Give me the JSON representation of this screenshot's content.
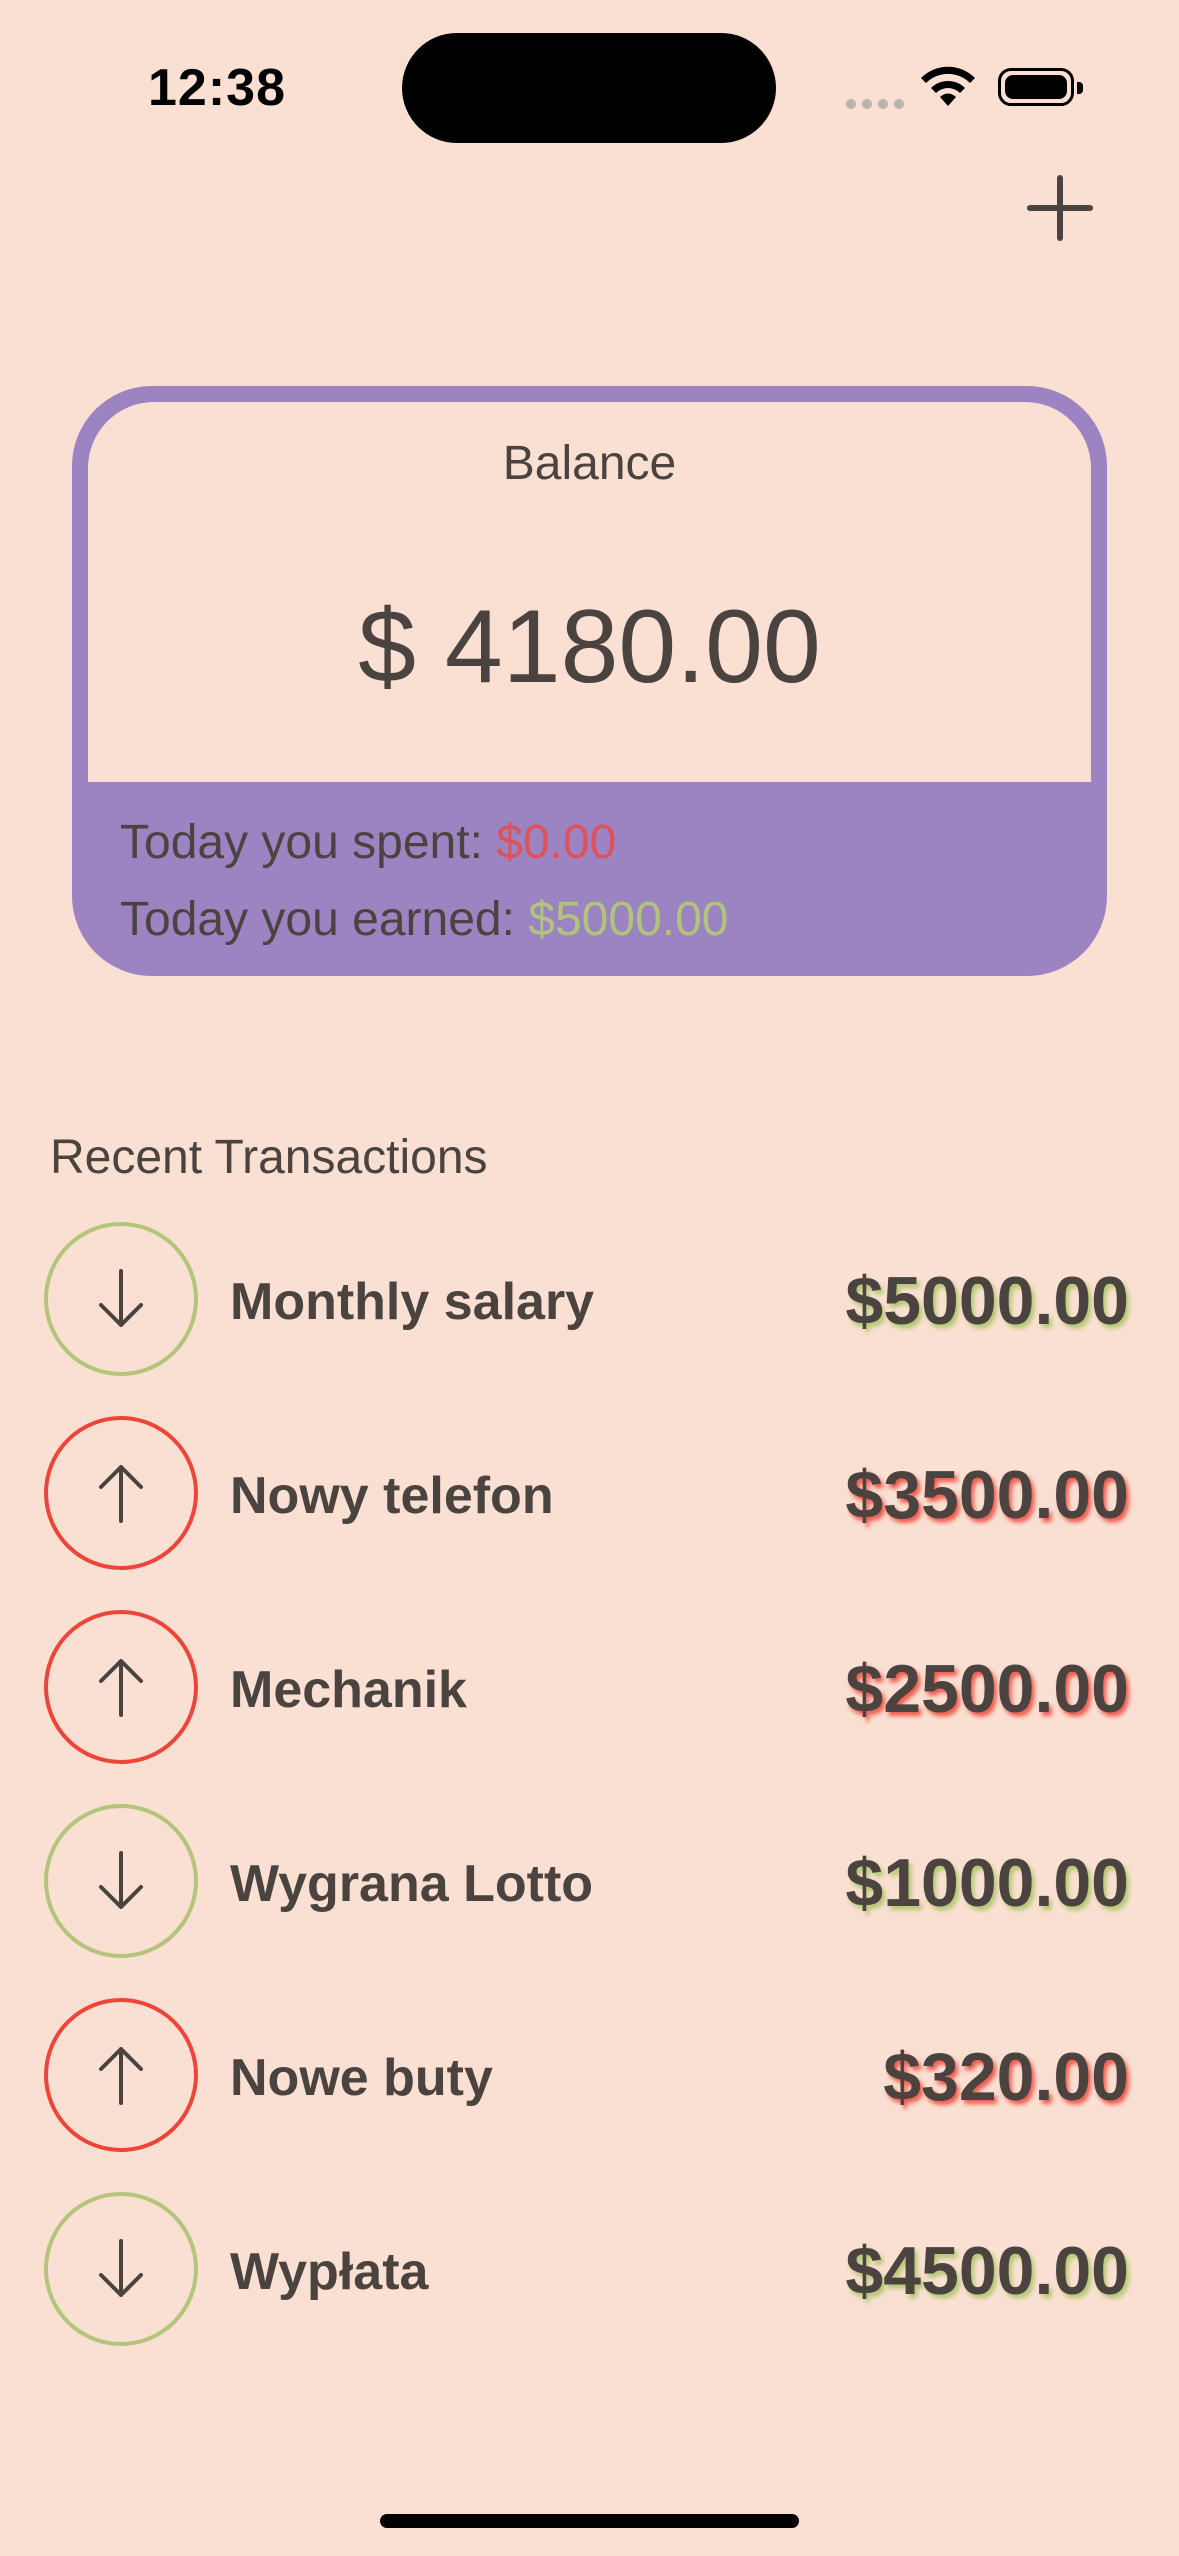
{
  "status_bar": {
    "time": "12:38"
  },
  "header": {
    "add_icon": "plus-icon"
  },
  "balance": {
    "label": "Balance",
    "amount": "$ 4180.00",
    "spent_label": "Today you spent: ",
    "spent_value": "$0.00",
    "earned_label": "Today you earned: ",
    "earned_value": "$5000.00"
  },
  "recent": {
    "title": "Recent Transactions",
    "items": [
      {
        "name": "Monthly salary",
        "amount": "$5000.00",
        "direction": "income",
        "icon": "arrow-down-icon"
      },
      {
        "name": "Nowy telefon",
        "amount": "$3500.00",
        "direction": "expense",
        "icon": "arrow-up-icon"
      },
      {
        "name": "Mechanik",
        "amount": "$2500.00",
        "direction": "expense",
        "icon": "arrow-up-icon"
      },
      {
        "name": "Wygrana Lotto",
        "amount": "$1000.00",
        "direction": "income",
        "icon": "arrow-down-icon"
      },
      {
        "name": "Nowe buty",
        "amount": "$320.00",
        "direction": "expense",
        "icon": "arrow-up-icon"
      },
      {
        "name": "Wypłata",
        "amount": "$4500.00",
        "direction": "income",
        "icon": "arrow-down-icon"
      }
    ]
  },
  "colors": {
    "background": "#fae0d2",
    "card": "#9c83c2",
    "income": "#b4c47a",
    "expense": "#ef4438",
    "text": "#4a4340"
  }
}
